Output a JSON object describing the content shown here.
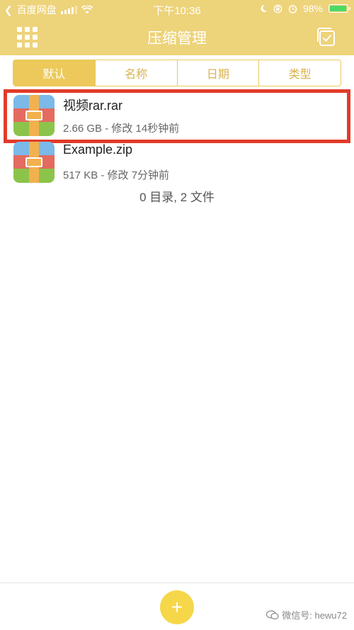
{
  "status_bar": {
    "back_app": "百度网盘",
    "time": "下午10:36",
    "battery": "98%",
    "battery_level": 0.98,
    "icons": [
      "chevron-left-icon",
      "signal-icon",
      "wifi-icon",
      "moon-icon",
      "rotation-lock-icon",
      "alarm-icon",
      "battery-icon"
    ]
  },
  "header": {
    "title": "压缩管理",
    "left_icon": "grid-menu-icon",
    "right_icon": "select-check-icon"
  },
  "tabs": [
    {
      "label": "默认",
      "active": true
    },
    {
      "label": "名称",
      "active": false
    },
    {
      "label": "日期",
      "active": false
    },
    {
      "label": "类型",
      "active": false
    }
  ],
  "files": [
    {
      "name": "视频rar.rar",
      "meta": "2.66 GB - 修改 14秒钟前",
      "icon": "zip-archive-icon",
      "highlighted": true
    },
    {
      "name": "Example.zip",
      "meta": "517 KB - 修改 7分钟前",
      "icon": "zip-archive-icon",
      "highlighted": false
    }
  ],
  "summary": "0 目录, 2 文件",
  "fab": {
    "label": "+",
    "icon": "plus-icon"
  },
  "watermark": "微信号: hewu72",
  "colors": {
    "header_bg": "#edd37a",
    "accent": "#ecc95a",
    "highlight_border": "#e13b2a",
    "fab_bg": "#f6d74a",
    "icon_stripes": [
      "#7ab9e8",
      "#e36b5f",
      "#8cc44b"
    ]
  }
}
